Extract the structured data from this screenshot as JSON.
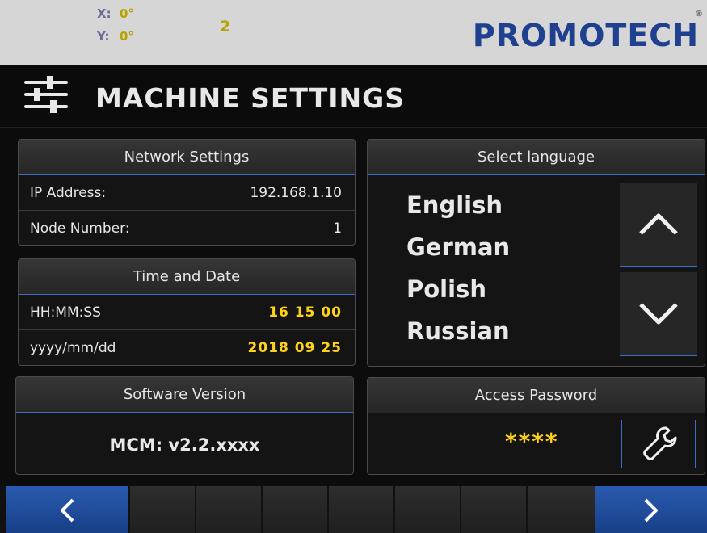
{
  "status": {
    "x_label": "X:",
    "x_value": "0°",
    "y_label": "Y:",
    "y_value": "0°",
    "number": "2",
    "logo": "PROMOTECH",
    "logo_mark": "®"
  },
  "page": {
    "title": "MACHINE SETTINGS",
    "icon": "sliders-icon"
  },
  "network": {
    "title": "Network Settings",
    "ip_label": "IP Address:",
    "ip_value": "192.168.1.10",
    "node_label": "Node Number:",
    "node_value": "1"
  },
  "time": {
    "title": "Time and Date",
    "time_label": "HH:MM:SS",
    "time_value": "16 15 00",
    "date_label": "yyyy/mm/dd",
    "date_value": "2018 09 25"
  },
  "software": {
    "title": "Software Version",
    "version": "MCM: v2.2.xxxx"
  },
  "language": {
    "title": "Select language",
    "items": [
      "English",
      "German",
      "Polish",
      "Russian"
    ],
    "up_icon": "chevron-up-icon",
    "down_icon": "chevron-down-icon"
  },
  "password": {
    "title": "Access Password",
    "masked": "****",
    "icon": "wrench-icon"
  },
  "colors": {
    "accent_blue": "#2a5bb0",
    "value_yellow": "#ffd21a",
    "logo_blue": "#1f3f8f"
  },
  "nav": {
    "prev_icon": "chevron-left-icon",
    "next_icon": "chevron-right-icon"
  }
}
